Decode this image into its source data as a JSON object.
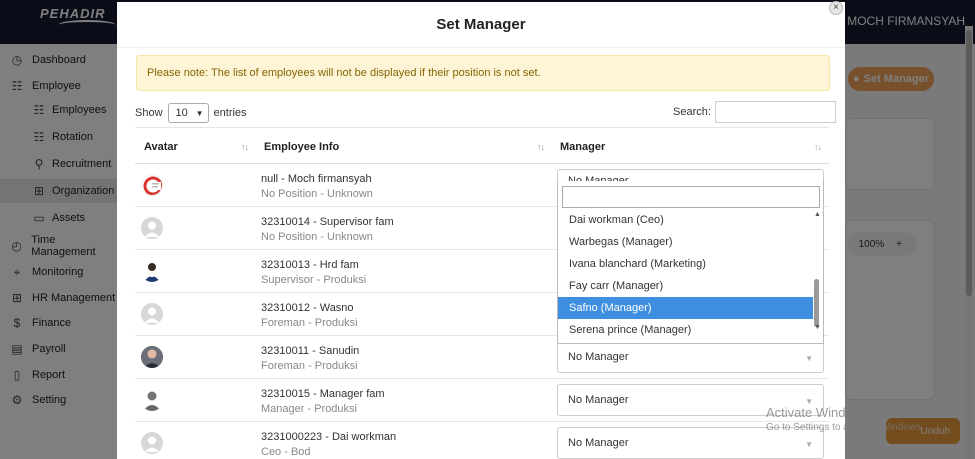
{
  "app": {
    "logo_text": "PEHADIR",
    "user_name": "MOCH FIRMANSYAH"
  },
  "sidebar": {
    "items": [
      {
        "label": "Dashboard",
        "icon": "dashboard-icon"
      },
      {
        "label": "Employee",
        "icon": "users-icon"
      },
      {
        "label": "Employees",
        "icon": "users-icon",
        "sub": true
      },
      {
        "label": "Rotation",
        "icon": "rotation-icon",
        "sub": true
      },
      {
        "label": "Recruitment",
        "icon": "recruitment-icon",
        "sub": true
      },
      {
        "label": "Organization",
        "icon": "organization-icon",
        "sub": true,
        "active": true
      },
      {
        "label": "Assets",
        "icon": "laptop-icon",
        "sub": true
      },
      {
        "label": "Time Management",
        "icon": "clock-icon"
      },
      {
        "label": "Monitoring",
        "icon": "location-icon"
      },
      {
        "label": "HR Management",
        "icon": "hr-icon"
      },
      {
        "label": "Finance",
        "icon": "dollar-icon"
      },
      {
        "label": "Payroll",
        "icon": "payroll-icon"
      },
      {
        "label": "Report",
        "icon": "report-icon"
      },
      {
        "label": "Setting",
        "icon": "gear-icon"
      }
    ]
  },
  "background": {
    "set_manager_label": "Set Manager",
    "zoom": "100%",
    "zoom_plus": "+",
    "download_label": "Unduh",
    "activate_title": "Activate Windows",
    "activate_sub": "Go to Settings to activate Windows."
  },
  "modal": {
    "close_symbol": "×",
    "title": "Set Manager",
    "alert": "Please note: The list of employees will not be displayed if their position is not set.",
    "show_label": "Show",
    "entries_value": "10",
    "entries_label": "entries",
    "search_label": "Search:",
    "search_value": "",
    "columns": {
      "avatar": "Avatar",
      "employee_info": "Employee Info",
      "manager": "Manager"
    },
    "rows": [
      {
        "name": "null - Moch firmansyah",
        "position": "No Position - Unknown",
        "manager": "No Manager",
        "avatar": "logo"
      },
      {
        "name": "32310014 - Supervisor fam",
        "position": "No Position - Unknown",
        "manager": "No Manager",
        "avatar": "gray"
      },
      {
        "name": "32310013 - Hrd fam",
        "position": "Supervisor - Produksi",
        "manager": "No Manager",
        "avatar": "photo"
      },
      {
        "name": "32310012 - Wasno",
        "position": "Foreman - Produksi",
        "manager": "No Manager",
        "avatar": "gray"
      },
      {
        "name": "32310011 - Sanudin",
        "position": "Foreman - Produksi",
        "manager": "No Manager",
        "avatar": "photo2"
      },
      {
        "name": "32310015 - Manager fam",
        "position": "Manager - Produksi",
        "manager": "No Manager",
        "avatar": "silhouette"
      },
      {
        "name": "3231000223 - Dai workman",
        "position": "Ceo - Bod",
        "manager": "No Manager",
        "avatar": "gray"
      }
    ],
    "dropdown": {
      "search_value": "",
      "options": [
        "Dai workman (Ceo)",
        "Warbegas (Manager)",
        "Ivana blanchard (Marketing)",
        "Fay carr (Manager)",
        "Safno (Manager)",
        "Serena prince (Manager)"
      ],
      "selected_index": 4
    }
  },
  "colors": {
    "accent": "#f0a057",
    "selected": "#3f8fe0",
    "alert_bg": "#fdf5d5",
    "alert_text": "#856404"
  }
}
